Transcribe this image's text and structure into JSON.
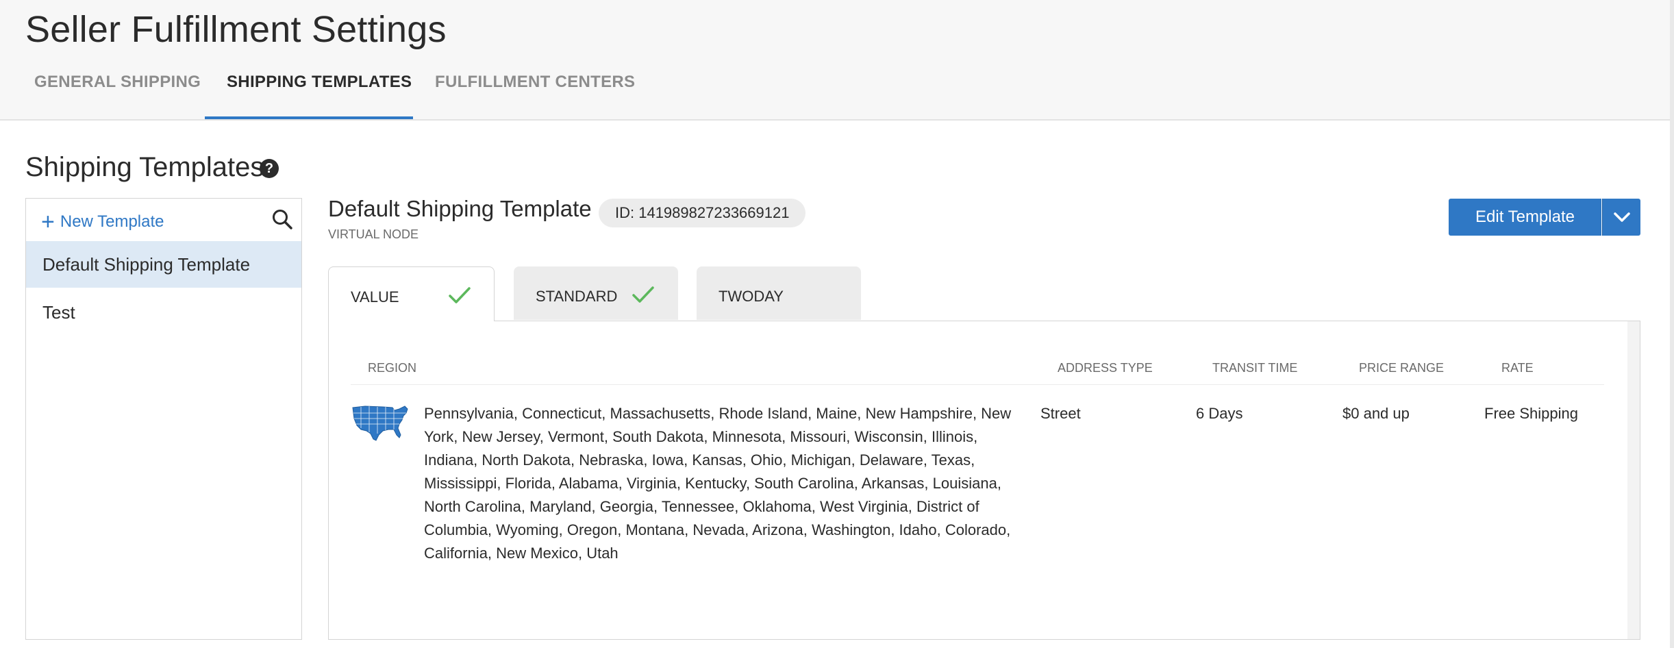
{
  "page": {
    "title": "Seller Fulfillment Settings"
  },
  "nav": {
    "tabs": [
      {
        "label": "GENERAL SHIPPING"
      },
      {
        "label": "SHIPPING TEMPLATES"
      },
      {
        "label": "FULFILLMENT CENTERS"
      }
    ],
    "active": "SHIPPING TEMPLATES"
  },
  "section": {
    "title": "Shipping Templates",
    "help_glyph": "?"
  },
  "sidebar": {
    "new_template_label": "New Template",
    "plus_glyph": "+",
    "items": [
      {
        "label": "Default Shipping Template",
        "selected": true
      },
      {
        "label": "Test",
        "selected": false
      }
    ]
  },
  "template": {
    "title": "Default Shipping Template",
    "subtitle": "VIRTUAL NODE",
    "id_label": "ID: 141989827233669121",
    "edit_label": "Edit Template"
  },
  "service_tabs": [
    {
      "label": "VALUE",
      "checked": true,
      "active": true
    },
    {
      "label": "STANDARD",
      "checked": true,
      "active": false
    },
    {
      "label": "TWODAY",
      "checked": false,
      "active": false
    }
  ],
  "table": {
    "columns": [
      "REGION",
      "ADDRESS TYPE",
      "TRANSIT TIME",
      "PRICE RANGE",
      "RATE"
    ],
    "rows": [
      {
        "region": "Pennsylvania, Connecticut, Massachusetts, Rhode Island, Maine, New Hampshire, New York, New Jersey, Vermont, South Dakota, Minnesota, Missouri, Wisconsin, Illinois, Indiana, North Dakota, Nebraska, Iowa, Kansas, Ohio, Michigan, Delaware, Texas, Mississippi, Florida, Alabama, Virginia, Kentucky, South Carolina, Arkansas, Louisiana, North Carolina, Maryland, Georgia, Tennessee, Oklahoma, West Virginia, District of Columbia, Wyoming, Oregon, Montana, Nevada, Arizona, Washington, Idaho, Colorado, California, New Mexico, Utah",
        "address_type": "Street",
        "transit_time": "6 Days",
        "price_range": "$0 and up",
        "rate": "Free Shipping"
      }
    ]
  },
  "colors": {
    "accent": "#2f78c5",
    "check": "#5cb85c",
    "selected_bg": "#dde9f5"
  },
  "icons": [
    "help-icon",
    "plus-icon",
    "search-icon",
    "chevron-down-icon",
    "check-icon",
    "us-map-icon"
  ]
}
